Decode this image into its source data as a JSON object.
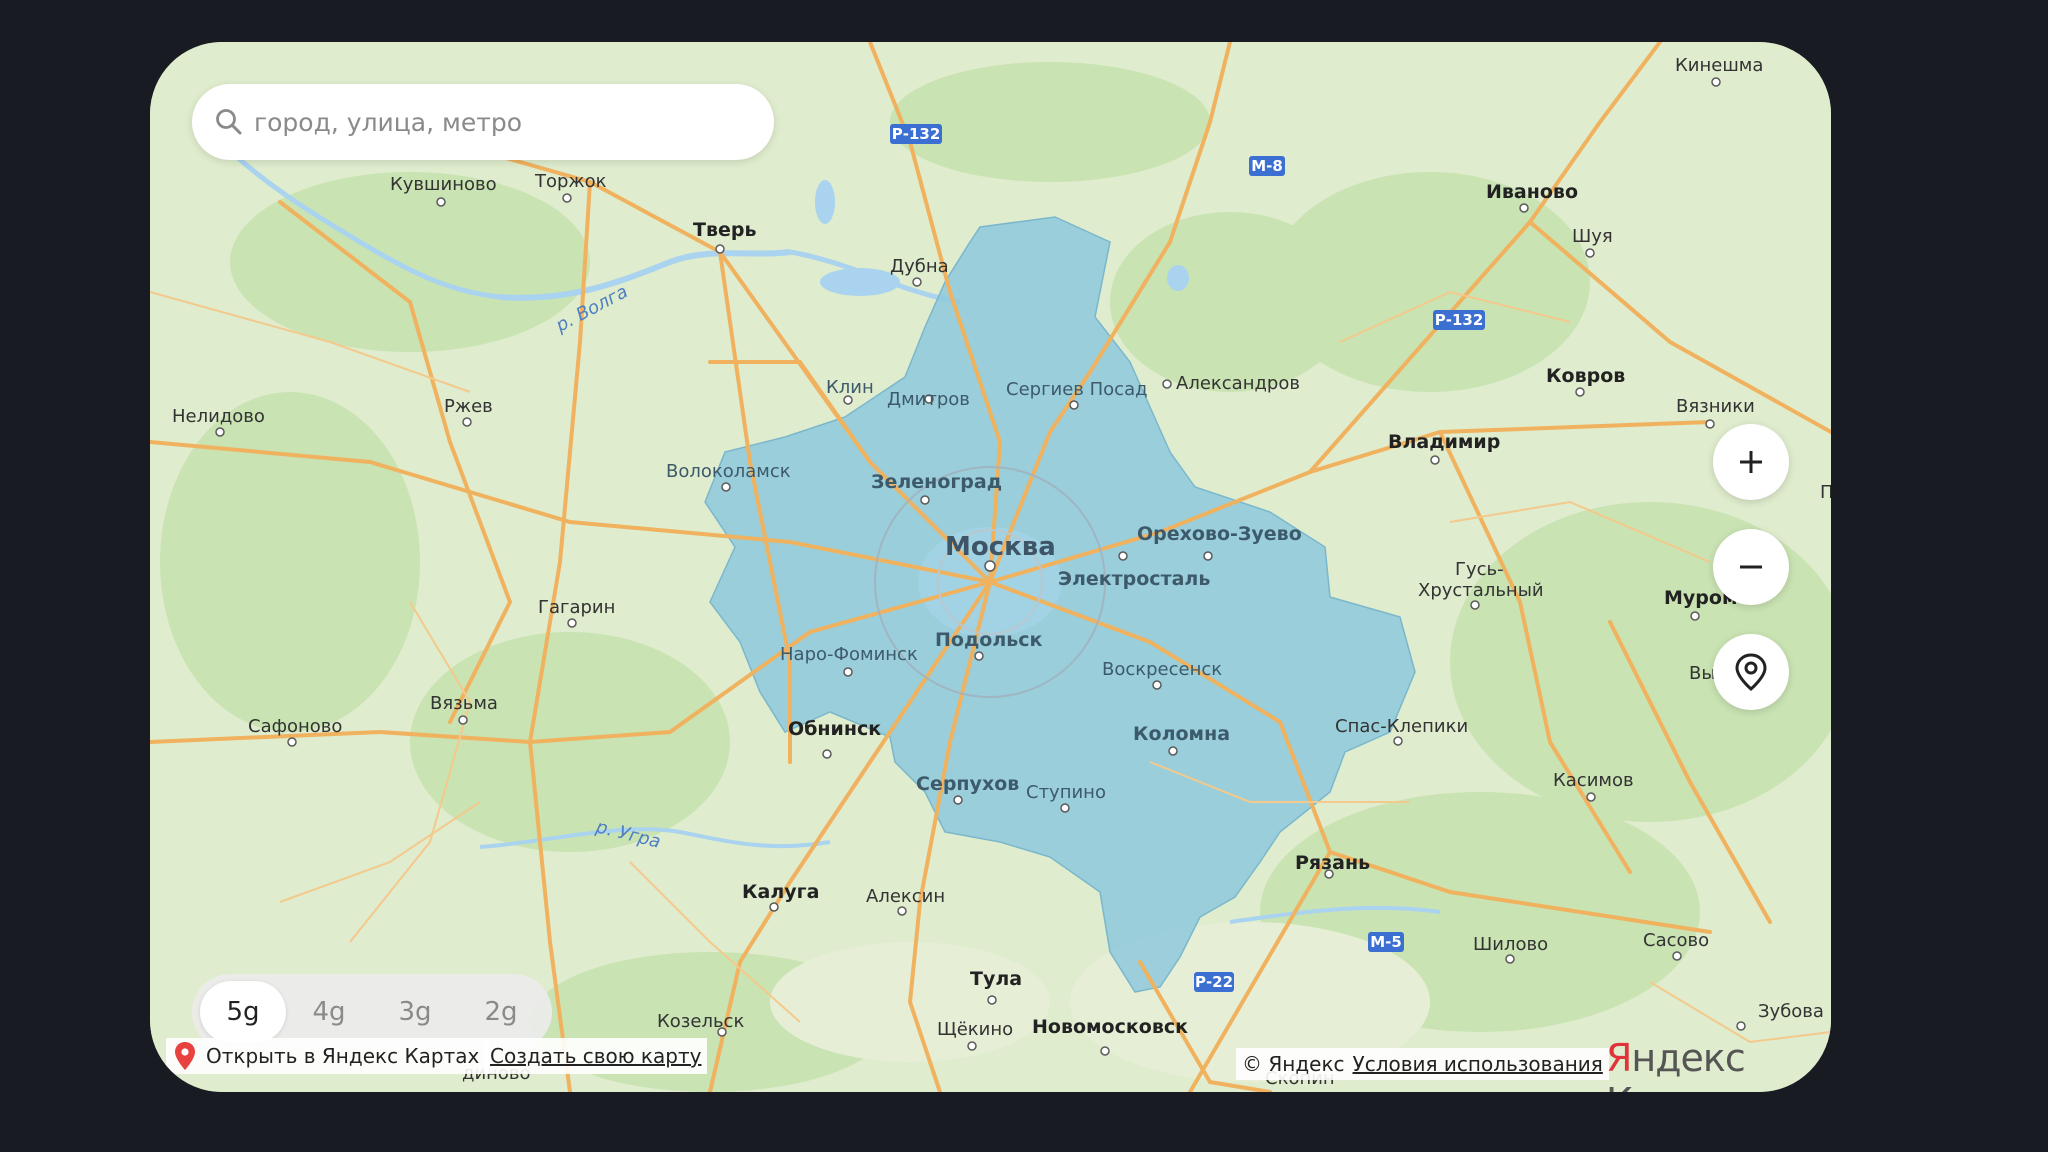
{
  "search": {
    "placeholder": "город, улица, метро"
  },
  "controls": {
    "zoom_in_icon": "plus-icon",
    "zoom_out_icon": "minus-icon",
    "locate_icon": "location-target-icon"
  },
  "network_tabs": [
    {
      "label": "5g",
      "active": true
    },
    {
      "label": "4g",
      "active": false
    },
    {
      "label": "3g",
      "active": false
    },
    {
      "label": "2g",
      "active": false
    }
  ],
  "footer": {
    "open_in_maps": "Открыть в Яндекс Картах",
    "create_map": "Создать свою карту",
    "copyright": "© Яндекс",
    "terms": "Условия использования",
    "logo_first": "Я",
    "logo_rest": "ндекс Карты"
  },
  "colors": {
    "coverage_fill": "#8ec9dc",
    "land": "#dfeccd",
    "forest": "#c9e3b3",
    "road": "#f0b25e",
    "water": "#a9d3ef",
    "road_shield": "#3b6fd1",
    "logo_red": "#e0343a"
  },
  "map": {
    "cities": {
      "moscow": "Москва",
      "tver": "Тверь",
      "torzhok": "Торжок",
      "kuvshinovo": "Кувшиново",
      "dubna": "Дубна",
      "kineshma": "Кинешма",
      "ivanovo": "Иваново",
      "shuya": "Шуя",
      "kovrov": "Ковров",
      "vyazniki": "Вязники",
      "vladimir": "Владимир",
      "aleksandrov": "Александров",
      "sergiev_posad": "Сергиев Посад",
      "dmitrov": "Дмитров",
      "klin": "Клин",
      "nelidovo": "Нелидово",
      "rzhev": "Ржев",
      "volokolamsk": "Волоколамск",
      "zelenograd": "Зеленоград",
      "orekhovo_zuevo": "Орехово-Зуево",
      "elektrostal": "Электросталь",
      "gus_1": "Гусь-",
      "gus_2": "Хрустальный",
      "murom": "Муром",
      "vy": "Вы",
      "gagarin": "Гагарин",
      "naro_fominsk": "Наро-Фоминск",
      "podolsk": "Подольск",
      "voskresensk": "Воскресенск",
      "vyazma": "Вязьма",
      "safonovo": "Сафоново",
      "obninsk": "Обнинск",
      "kolomna": "Коломна",
      "spas_klepiki": "Спас-Клепики",
      "kasimov": "Касимов",
      "serpukhov": "Серпухов",
      "stupino": "Ступино",
      "ryazan": "Рязань",
      "kaluga": "Калуга",
      "aleksin": "Алексин",
      "shilovo": "Шилово",
      "sasovo": "Сасово",
      "tula": "Тула",
      "kozelsk": "Козельск",
      "shchekino": "Щёкино",
      "novomoskovsk": "Новомосковск",
      "skopin": "Скопин",
      "zubova": "Зубова П",
      "dinovo": "диново",
      "p_edge": "П"
    },
    "rivers": {
      "volga": "р. Волга",
      "ugra": "р. Угра"
    },
    "roads": {
      "r132": "Р-132",
      "m8": "М-8",
      "r22": "Р-22",
      "m5": "М-5"
    }
  }
}
